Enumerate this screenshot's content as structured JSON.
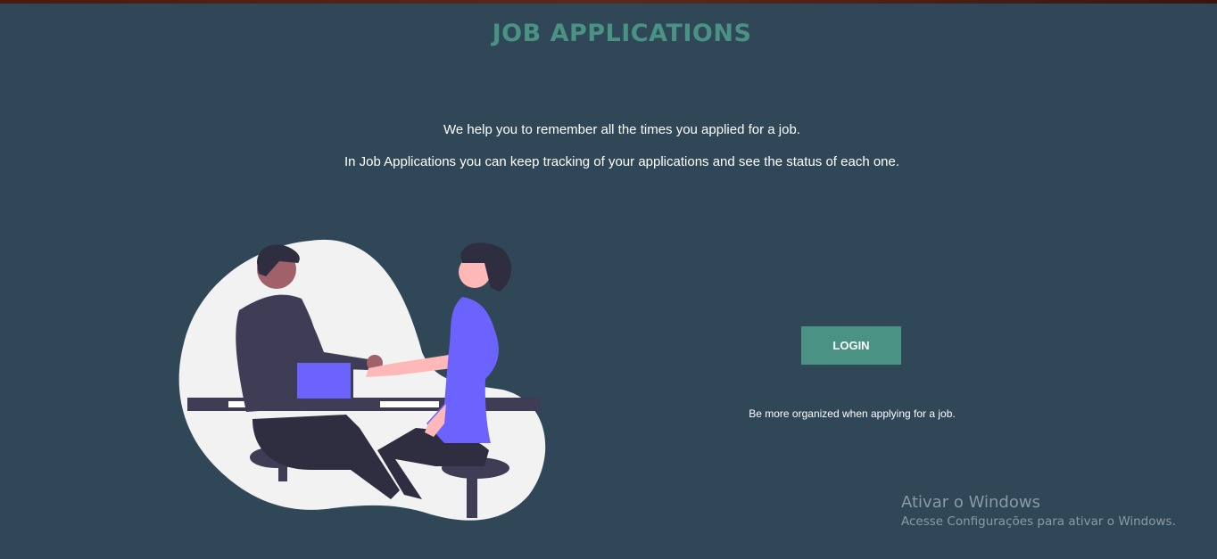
{
  "header": {
    "title": "JOB APPLICATIONS"
  },
  "intro": {
    "line1": "We help you to remember all the times you applied for a job.",
    "line2": "In Job Applications you can keep tracking of your applications and see the status of each one."
  },
  "login": {
    "button_label": "LOGIN"
  },
  "tagline": "Be more organized when applying for a job.",
  "os_watermark": {
    "title": "Ativar o Windows",
    "subtitle": "Acesse Configurações para ativar o Windows."
  },
  "colors": {
    "background": "#2f4757",
    "accent": "#4a9283",
    "illustration_blob": "#f2f2f2",
    "illustration_purple": "#6c63ff",
    "illustration_dark": "#2f2e41"
  }
}
